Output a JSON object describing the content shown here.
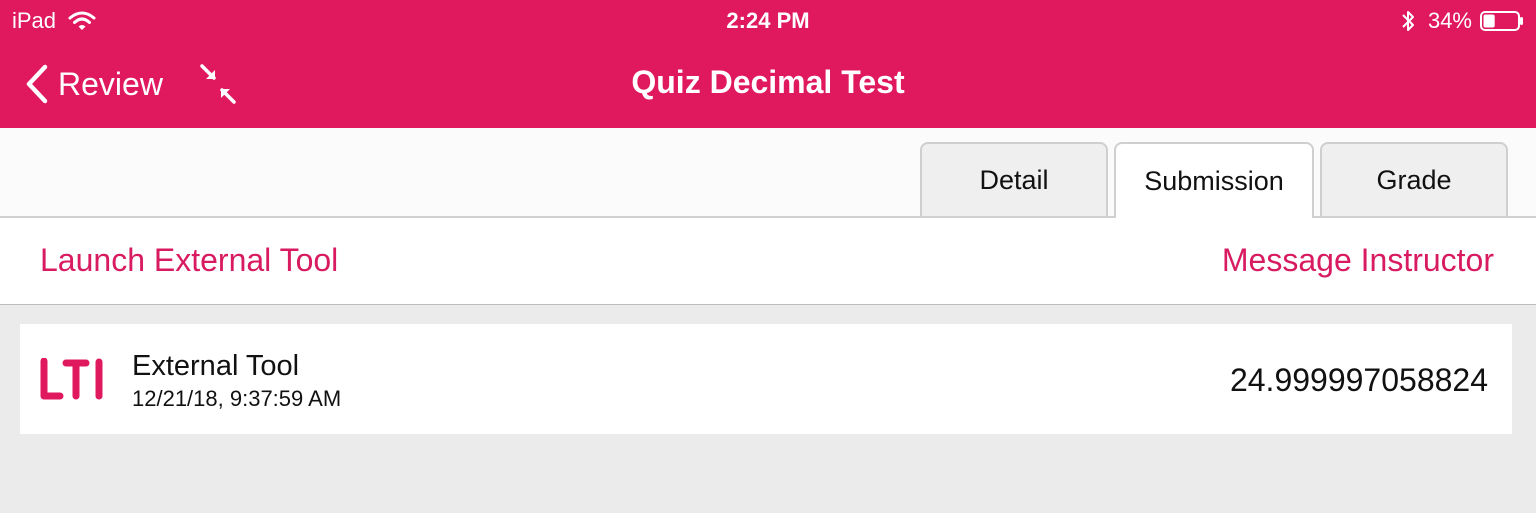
{
  "status_bar": {
    "device": "iPad",
    "time": "2:24 PM",
    "battery": "34%",
    "battery_level": 0.34,
    "icons": [
      "wifi-icon",
      "bluetooth-icon",
      "battery-icon"
    ]
  },
  "nav": {
    "back_label": "Review",
    "title": "Quiz Decimal Test",
    "icons": [
      "chevron-left-icon",
      "collapse-arrows-icon"
    ]
  },
  "tabs": [
    {
      "label": "Detail",
      "active": false
    },
    {
      "label": "Submission",
      "active": true
    },
    {
      "label": "Grade",
      "active": false
    }
  ],
  "actions": {
    "launch": "Launch External Tool",
    "message": "Message Instructor"
  },
  "submission": {
    "logo_text": "LTI",
    "title": "External Tool",
    "date": "12/21/18, 9:37:59 AM",
    "score": "24.999997058824"
  },
  "colors": {
    "brand": "#e0195e",
    "link": "#d81b60",
    "background": "#ebebeb"
  }
}
